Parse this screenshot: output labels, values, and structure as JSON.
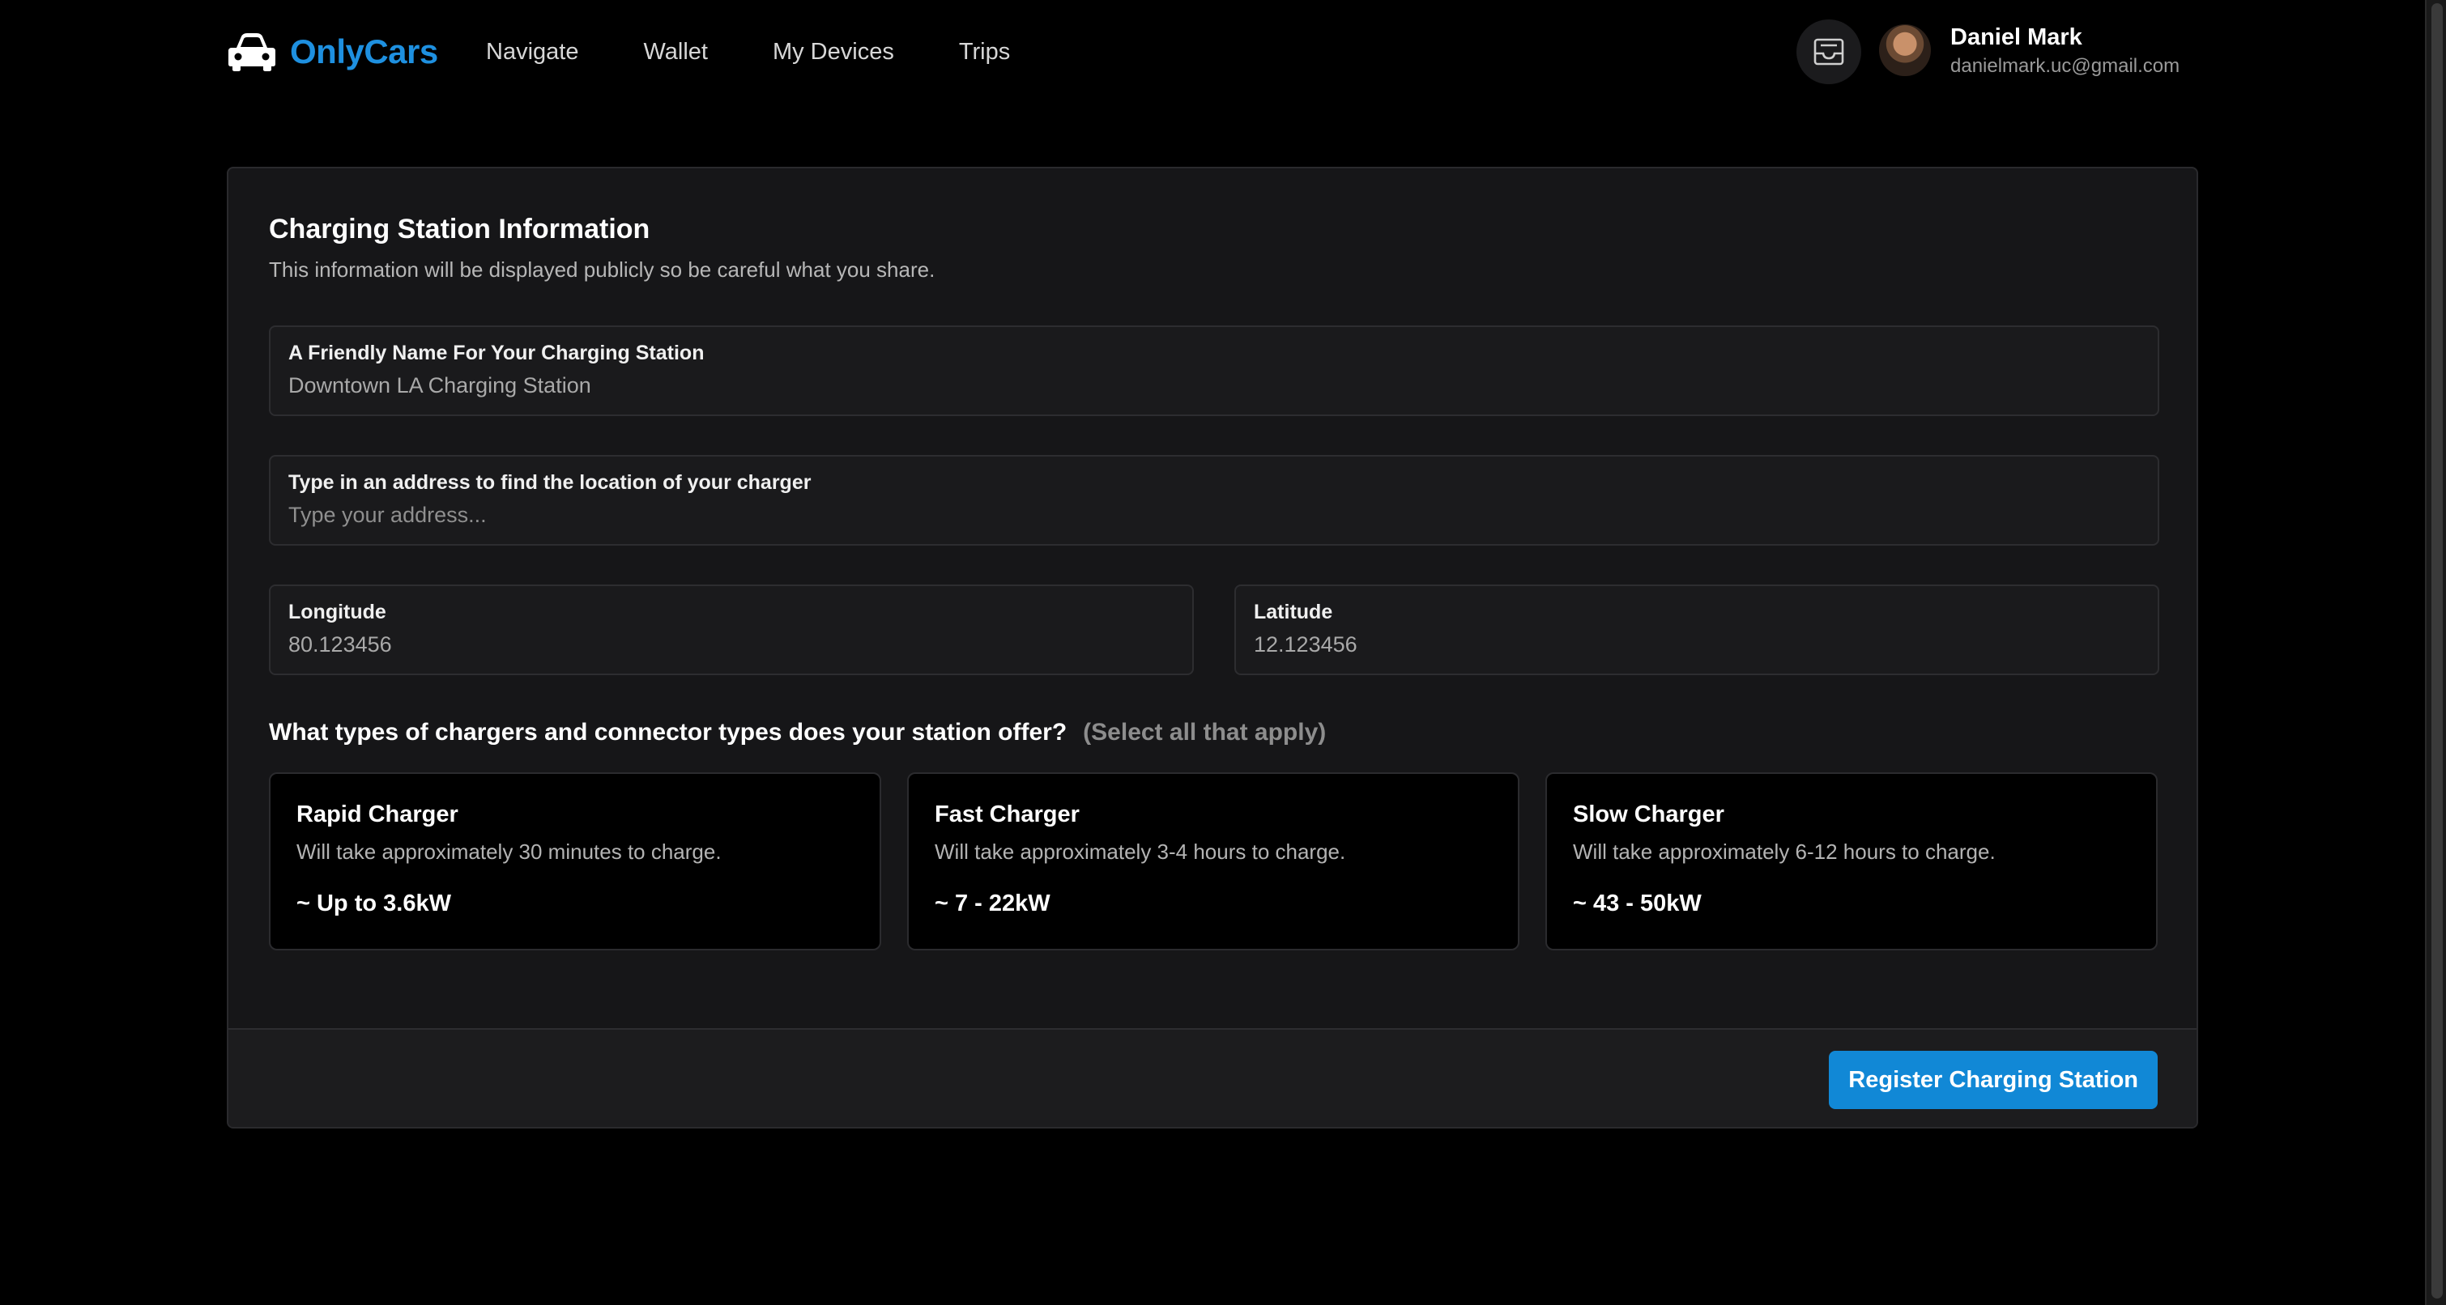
{
  "brand": {
    "name": "OnlyCars",
    "icon": "car-icon",
    "color": "#1e90e0"
  },
  "nav": [
    {
      "label": "Navigate"
    },
    {
      "label": "Wallet"
    },
    {
      "label": "My Devices"
    },
    {
      "label": "Trips"
    }
  ],
  "user": {
    "name": "Daniel Mark",
    "email": "danielmark.uc@gmail.com",
    "inbox_icon": "inbox-icon"
  },
  "form": {
    "title": "Charging Station Information",
    "subtitle": "This information will be displayed publicly so be careful what you share.",
    "name_field": {
      "label": "A Friendly Name For Your Charging Station",
      "value": "Downtown LA Charging Station"
    },
    "address_field": {
      "label": "Type in an address to find the location of your charger",
      "placeholder": "Type your address..."
    },
    "longitude_field": {
      "label": "Longitude",
      "value": "80.123456"
    },
    "latitude_field": {
      "label": "Latitude",
      "value": "12.123456"
    },
    "question": "What types of chargers and connector types does your station offer?",
    "question_hint": "(Select all that apply)",
    "chargers": [
      {
        "title": "Rapid Charger",
        "desc": "Will take approximately 30 minutes to charge.",
        "power": "~ Up to 3.6kW"
      },
      {
        "title": "Fast Charger",
        "desc": "Will take approximately 3-4 hours to charge.",
        "power": "~ 7 - 22kW"
      },
      {
        "title": "Slow Charger",
        "desc": "Will take approximately 6-12 hours to charge.",
        "power": "~ 43 - 50kW"
      }
    ],
    "submit_label": "Register Charging Station",
    "accent": "#1188d6"
  }
}
